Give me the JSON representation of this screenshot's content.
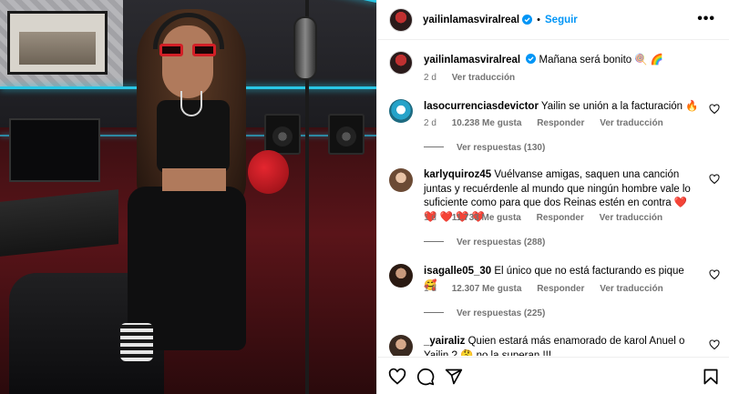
{
  "post": {
    "username": "yailinlamasviralreal",
    "follow_label": "Seguir",
    "more_label": "•••",
    "separator": "•"
  },
  "caption": {
    "username": "yailinlamasviralreal",
    "text": "Mañana será bonito 🍭 🌈",
    "time": "2 d",
    "translate_label": "Ver traducción"
  },
  "comments": [
    {
      "username": "lasocurrenciasdevictor",
      "text": "Yailin se unión a la facturación 🔥",
      "time": "2 d",
      "likes": "10.238 Me gusta",
      "reply_label": "Responder",
      "translate_label": "Ver traducción",
      "replies_label": "Ver respuestas (130)"
    },
    {
      "username": "karlyquiroz45",
      "text": "Vuélvanse amigas, saquen una canción juntas y recuérdenle al mundo que ningún hombre vale lo suficiente como para que dos Reinas estén en contra ❤️ ❤️ ❤️ ❤️ ❤️",
      "time": "1 d",
      "likes": "11.733 Me gusta",
      "reply_label": "Responder",
      "translate_label": "Ver traducción",
      "replies_label": "Ver respuestas (288)"
    },
    {
      "username": "isagalle05_30",
      "text": "El único que no está facturando es pique 🥰",
      "time": "1 d",
      "likes": "12.307 Me gusta",
      "reply_label": "Responder",
      "translate_label": "Ver traducción",
      "replies_label": "Ver respuestas (225)"
    },
    {
      "username": "_yairaliz",
      "text": "Quien estará más enamorado de karol Anuel o Yailin ? 🤔 no la superan !!!",
      "time": "",
      "likes": "",
      "reply_label": "",
      "translate_label": "",
      "replies_label": ""
    }
  ],
  "colors": {
    "follow": "#0095f6",
    "verified": "#0095f6",
    "muted": "#737373"
  },
  "icons": [
    "more-options-icon",
    "verified-badge-icon",
    "heart-icon",
    "comment-icon",
    "share-icon",
    "bookmark-icon"
  ]
}
